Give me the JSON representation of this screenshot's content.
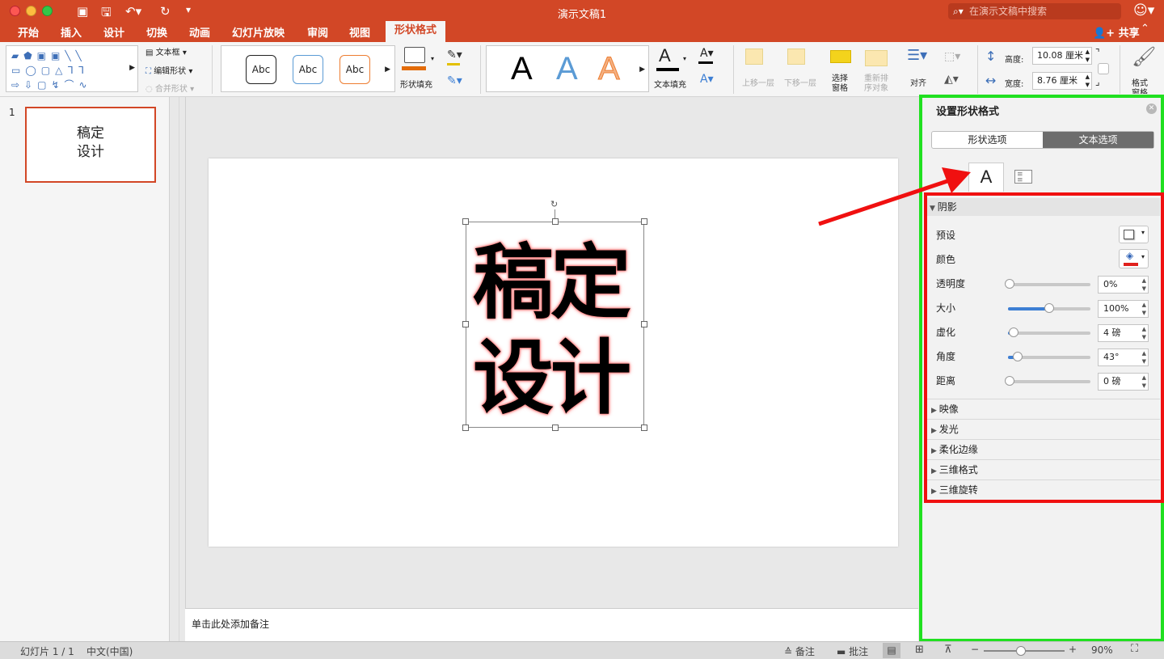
{
  "window": {
    "title": "演示文稿1",
    "search_placeholder": "在演示文稿中搜索",
    "share_label": "共享"
  },
  "tabs": [
    "开始",
    "插入",
    "设计",
    "切换",
    "动画",
    "幻灯片放映",
    "审阅",
    "视图",
    "形状格式"
  ],
  "active_tab": "形状格式",
  "ribbon": {
    "text_box": "文本框",
    "edit_shape": "编辑形状",
    "merge_shapes": "合并形状",
    "style_samples": [
      "Abc",
      "Abc",
      "Abc"
    ],
    "shape_fill": "形状填充",
    "wordart": [
      "A",
      "A",
      "A"
    ],
    "text_fill": "文本填充",
    "bring_forward": "上移一层",
    "send_backward": "下移一层",
    "selection_pane": [
      "选择",
      "窗格"
    ],
    "reorder_objects": [
      "重新排",
      "序对象"
    ],
    "align": "对齐",
    "height_label": "高度:",
    "height_value": "10.08 厘米",
    "width_label": "宽度:",
    "width_value": "8.76 厘米",
    "format_pane": [
      "格式",
      "窗格"
    ]
  },
  "thumbnail": {
    "number": "1",
    "lines": [
      "稿定",
      "设计"
    ]
  },
  "slide": {
    "lines": [
      "稿定",
      "设计"
    ]
  },
  "notes_placeholder": "单击此处添加备注",
  "pane": {
    "title": "设置形状格式",
    "tab_shape": "形状选项",
    "tab_text": "文本选项",
    "shadow_header": "阴影",
    "rows": [
      {
        "label": "预设"
      },
      {
        "label": "颜色"
      },
      {
        "label": "透明度",
        "value": "0%",
        "level": 0
      },
      {
        "label": "大小",
        "value": "100%",
        "level": 0.5
      },
      {
        "label": "虚化",
        "value": "4 磅",
        "level": 0.07
      },
      {
        "label": "角度",
        "value": "43°",
        "level": 0.12
      },
      {
        "label": "距离",
        "value": "0 磅",
        "level": 0
      }
    ],
    "sections": [
      "映像",
      "发光",
      "柔化边缘",
      "三维格式",
      "三维旋转"
    ],
    "accent_color": "#e0201c"
  },
  "status": {
    "slide_info": "幻灯片 1 / 1",
    "language": "中文(中国)",
    "notes": "备注",
    "comments": "批注",
    "zoom": "90%"
  }
}
